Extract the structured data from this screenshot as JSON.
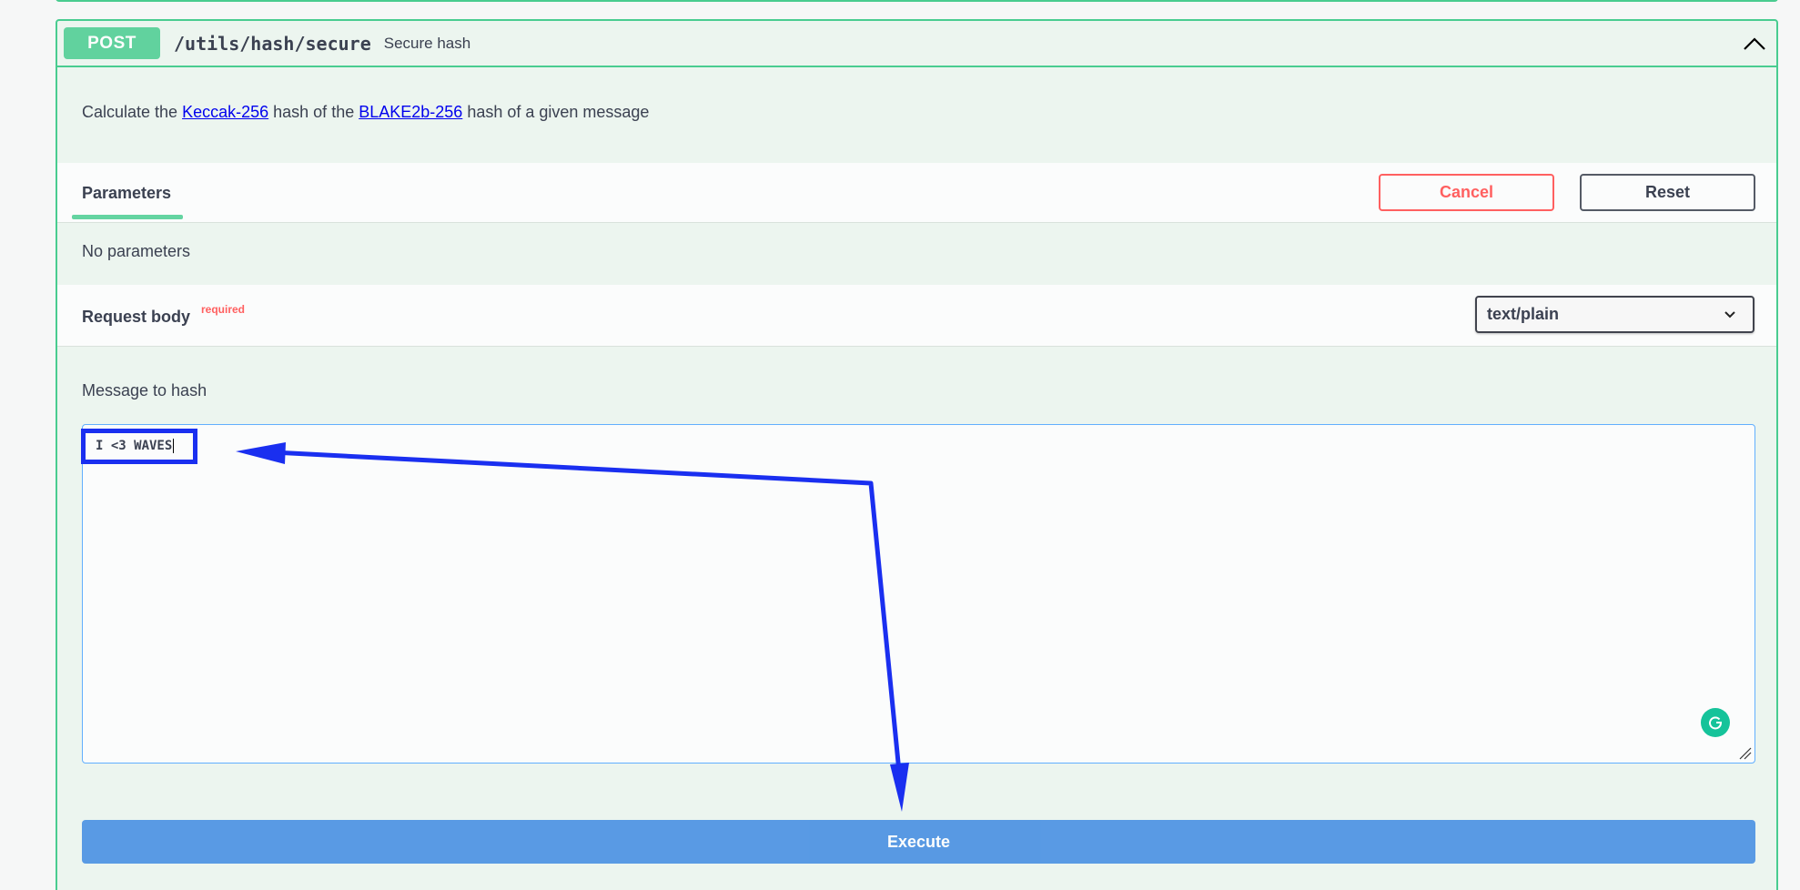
{
  "endpoint": {
    "method": "POST",
    "path": "/utils/hash/secure",
    "summary": "Secure hash",
    "description": {
      "prefix": "Calculate the ",
      "link1": "Keccak-256",
      "middle": " hash of the ",
      "link2": "BLAKE2b-256",
      "suffix": " hash of a given message"
    }
  },
  "parameters": {
    "tab_label": "Parameters",
    "cancel_label": "Cancel",
    "reset_label": "Reset",
    "empty_text": "No parameters"
  },
  "request_body": {
    "title": "Request body",
    "required_label": "required",
    "content_type": "text/plain",
    "field_label": "Message to hash",
    "value": "I <3 WAVES"
  },
  "execute_label": "Execute",
  "colors": {
    "post_accent": "#49cc90",
    "cancel": "#ff6060",
    "execute": "#4990e2",
    "annotation": "#1a2ff0"
  },
  "icons": [
    "chevron-up-icon",
    "chevron-down-icon",
    "grammarly-icon",
    "resize-handle-icon"
  ]
}
